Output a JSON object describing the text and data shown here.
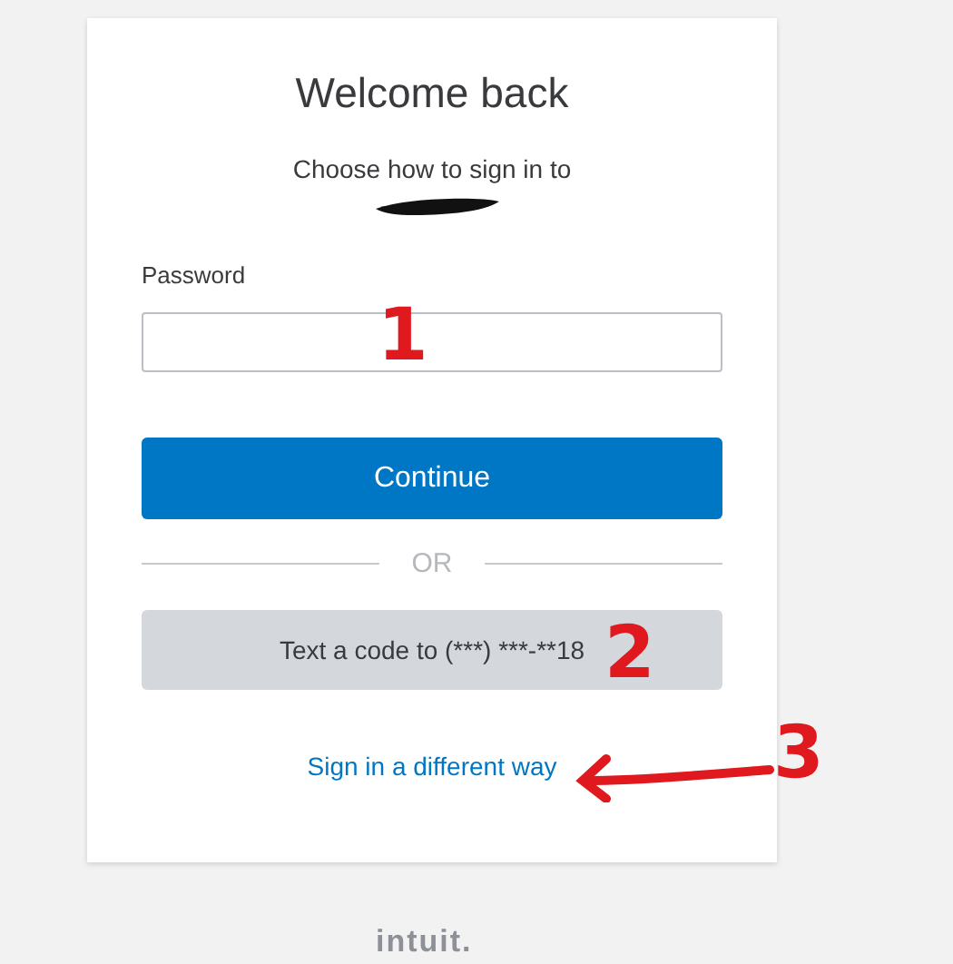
{
  "title": "Welcome back",
  "subtitle": "Choose how to sign in to",
  "password": {
    "label": "Password"
  },
  "continue_button": "Continue",
  "divider": "OR",
  "text_code_button": "Text a code to (***) ***-**18",
  "alternate_link": "Sign in a different way",
  "footer_logo": "intuit.",
  "annotations": [
    {
      "label": "1"
    },
    {
      "label": "2"
    },
    {
      "label": "3"
    }
  ]
}
